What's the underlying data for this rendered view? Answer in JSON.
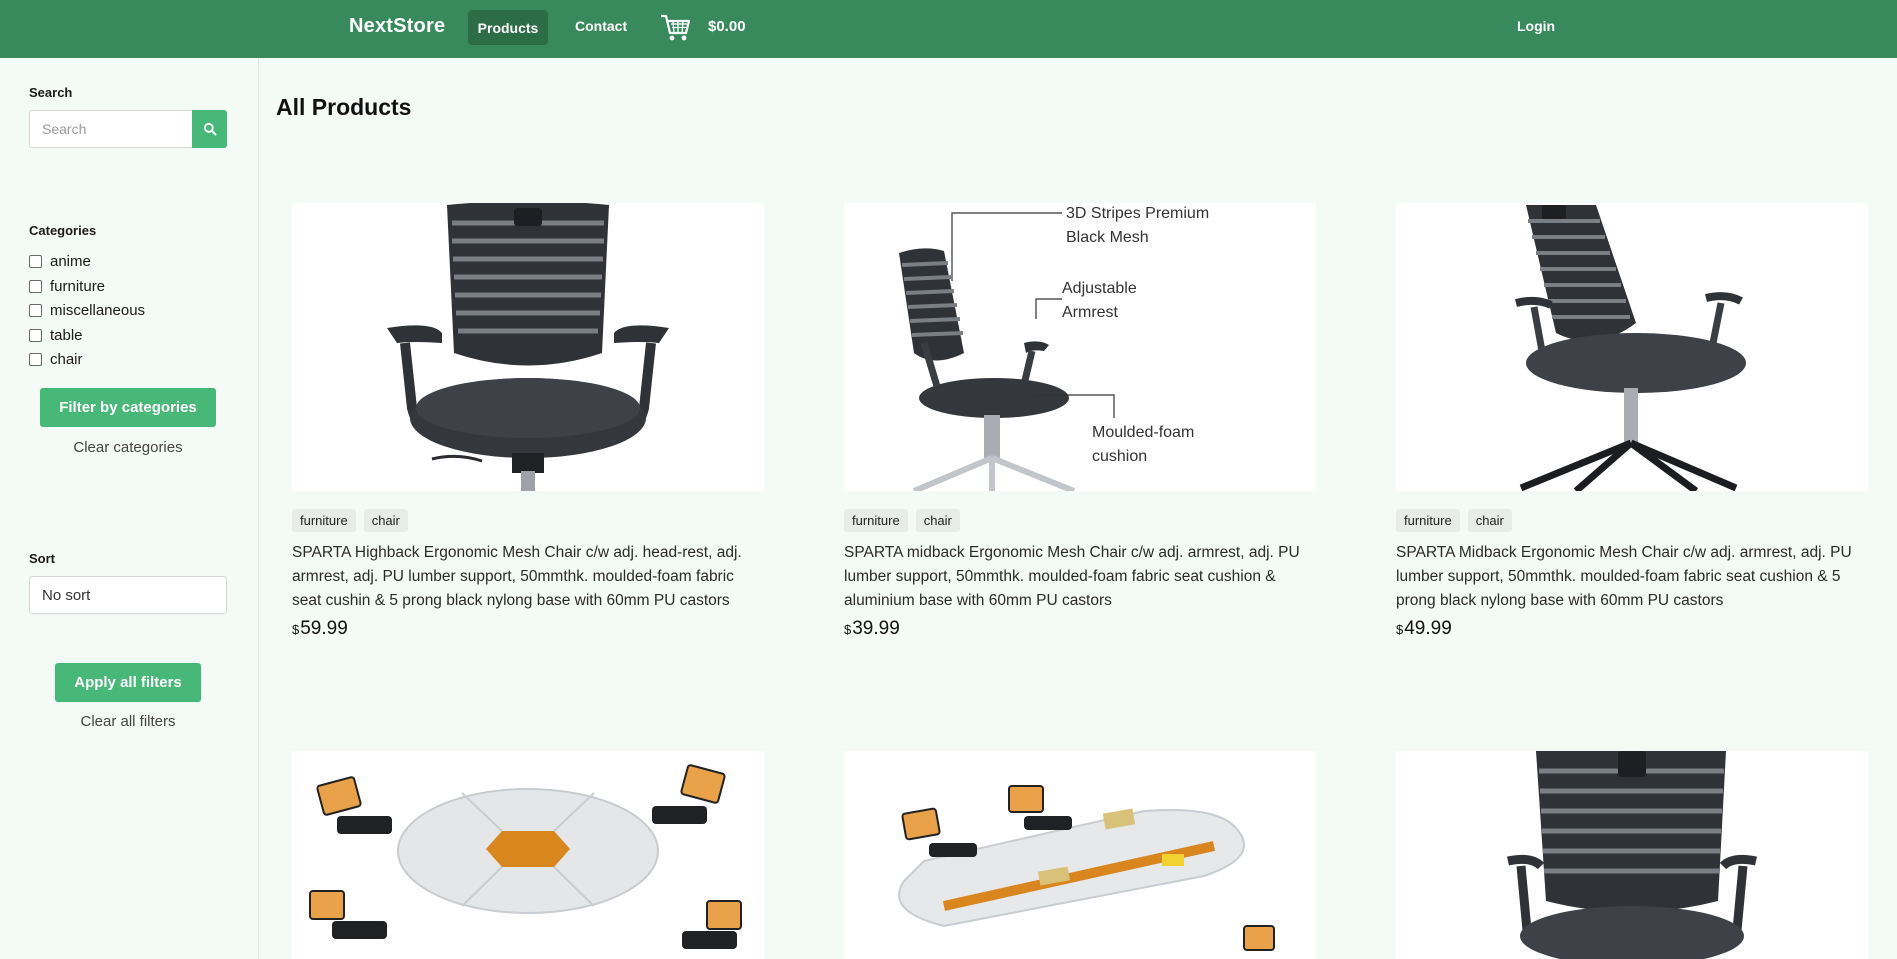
{
  "nav": {
    "brand": "NextStore",
    "products": "Products",
    "contact": "Contact",
    "cart_icon": "cart-icon",
    "cart_total": "$0.00",
    "login": "Login"
  },
  "sidebar": {
    "search_label": "Search",
    "search_placeholder": "Search",
    "search_icon": "search-icon",
    "categories_label": "Categories",
    "categories": [
      "anime",
      "furniture",
      "miscellaneous",
      "table",
      "chair"
    ],
    "filter_button": "Filter by categories",
    "clear_categories": "Clear categories",
    "sort_label": "Sort",
    "sort_value": "No sort",
    "apply_button": "Apply all filters",
    "clear_all": "Clear all filters"
  },
  "main": {
    "title": "All Products",
    "products": [
      {
        "tags": [
          "furniture",
          "chair"
        ],
        "description": "SPARTA Highback Ergonomic Mesh Chair c/w adj. head-rest, adj. armrest, adj. PU lumber support, 50mmthk. moulded-foam fabric seat cushin & 5 prong black nylong base with 60mm PU castors",
        "currency": "$",
        "price": "59.99"
      },
      {
        "tags": [
          "furniture",
          "chair"
        ],
        "description": "SPARTA midback Ergonomic Mesh Chair c/w adj. armrest, adj. PU lumber support, 50mmthk. moulded-foam fabric seat cushion & aluminium base with 60mm PU castors",
        "currency": "$",
        "price": "39.99",
        "image_callouts": [
          "3D Stripes Premium",
          "Black Mesh",
          "Adjustable",
          "Armrest",
          "Moulded-foam",
          "cushion"
        ]
      },
      {
        "tags": [
          "furniture",
          "chair"
        ],
        "description": "SPARTA Midback Ergonomic Mesh Chair c/w adj. armrest, adj. PU lumber support, 50mmthk. moulded-foam fabric seat cushion & 5 prong black nylong base with 60mm PU castors",
        "currency": "$",
        "price": "49.99"
      },
      {
        "image": "round-conference-table"
      },
      {
        "image": "long-conference-table"
      },
      {
        "image": "mesh-chair-front"
      }
    ]
  },
  "colors": {
    "nav_bg": "#388a5c",
    "nav_active": "#2c6d48",
    "button_green": "#48b878",
    "page_bg": "#f4faf6"
  }
}
